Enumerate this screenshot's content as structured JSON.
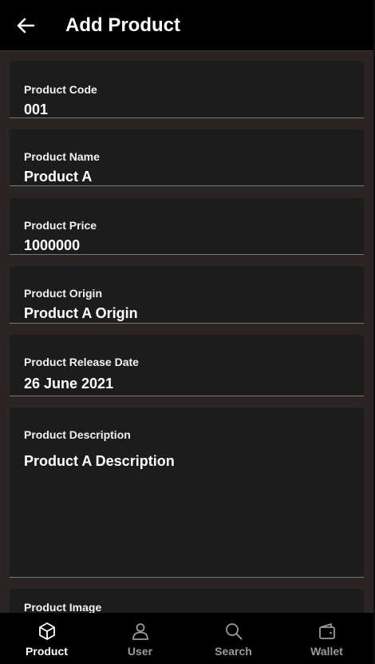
{
  "header": {
    "title": "Add Product",
    "back_icon": "arrow-left-icon"
  },
  "form": {
    "fields": [
      {
        "label": "Product Code",
        "value": "001"
      },
      {
        "label": "Product Name",
        "value": "Product A"
      },
      {
        "label": "Product Price",
        "value": "1000000"
      },
      {
        "label": "Product Origin",
        "value": "Product A Origin"
      },
      {
        "label": "Product Release Date",
        "value": "26 June 2021"
      },
      {
        "label": "Product Description",
        "value": "Product A Description"
      },
      {
        "label": "Product Image"
      }
    ]
  },
  "bottom_nav": {
    "items": [
      {
        "label": "Product",
        "icon": "cube-icon",
        "active": true
      },
      {
        "label": "User",
        "icon": "user-icon",
        "active": false
      },
      {
        "label": "Search",
        "icon": "search-icon",
        "active": false
      },
      {
        "label": "Wallet",
        "icon": "wallet-icon",
        "active": false
      }
    ]
  },
  "colors": {
    "background": "#2a2524",
    "surface": "#1c1c1c",
    "appbar": "#000000",
    "text": "#ffffff",
    "inactive": "#9a9a9a"
  }
}
